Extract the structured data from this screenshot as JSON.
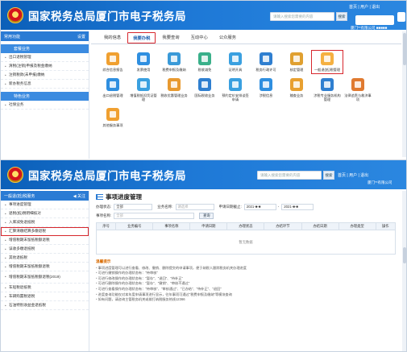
{
  "site_title": "国家税务总局厦门市电子税务局",
  "colors": {
    "banner": "#1d78d6",
    "highlight": "#d7262c",
    "accent": "#2a7bd4"
  },
  "shot1": {
    "search_placeholder": "请输入搜索您需要的内容",
    "search_button": "搜索",
    "top_links": "首页 | 用户 | 退出",
    "user_name": "厦门**有限公司 ■■■■■",
    "sidebar": {
      "head_label": "常用功能",
      "head_action": "设置",
      "groups": [
        {
          "label": "套餐业务",
          "items": [
            "出口退税管理",
            "清税(注销)申报及税金缴纳",
            "注销税款(未申报)缴纳",
            "新办税务信息"
          ]
        },
        {
          "label": "特色业务",
          "items": [
            "社保业务"
          ]
        }
      ]
    },
    "tabs": [
      "我的信息",
      "我要办税",
      "我要查询",
      "互动中心",
      "公众服务"
    ],
    "tiles": [
      "综合信息报告",
      "发票使用",
      "税费申报及缴纳",
      "税收减免",
      "证明开具",
      "税务行政许可",
      "核定管理",
      "一般退(抵)税管理",
      "",
      "出口退税管理",
      "增值税抵扣凭证管理",
      "税收优惠管理业务",
      "国际税收业务",
      "预约定价安排谈签申请",
      "涉税信息",
      "稽查业务",
      "涉税专业服务机构管理",
      "法律追责与救济事项",
      "其他服务事项"
    ],
    "highlight_index": 7
  },
  "shot2": {
    "search_placeholder": "请输入搜索您需要的内容",
    "search_button": "搜索",
    "top_links": "首页 | 用户 | 退出",
    "user_name": "厦门**有限公司",
    "sidebar": {
      "head_label": "一般退(抵)税服务",
      "head_action": "◀ 关注",
      "items": [
        "事项进度管理",
        "退税(抵)税明细核对",
        "入库减免退抵税",
        "汇算清缴结算多缴退税",
        "增值税期末留抵税额退税",
        "误收多缴退抵税",
        "其他退抵税",
        "增值税期末留抵税额退税",
        "增值税期末留抵税额退税(2019)",
        "车船税退抵税",
        "车辆购置税退税",
        "石油特别收益金退抵税"
      ],
      "highlight_index": 3
    },
    "panel_title": "事项进度管理",
    "filters": {
      "item_status_label": "办理状态:",
      "item_status_value": "全部",
      "tax_type_label": "业务名称:",
      "tax_type_value": "请选择",
      "date_label": "申请日期截止:",
      "date_from": "2021-■-■",
      "date_sep": "-",
      "date_to": "2021-■-■",
      "item_name_label": "事项名称:",
      "item_name_value": "全部",
      "query_button": "查询"
    },
    "table": {
      "headers": [
        "序号",
        "业务编号",
        "事项名称",
        "申请日期",
        "办理状态",
        "办结环节",
        "办结日期",
        "办理类型",
        "操作"
      ],
      "empty_text": "暂无数据"
    },
    "tips": {
      "title": "温馨提示",
      "lines": [
        "事项进度管理可以进行查看、修改、撤销、删除提交的申请事项，便于纳税人跟踪税务机关办理进度",
        "可进行撤销操作的办理状态有：\"待审核\"",
        "可进行修改操作的办理状态有：\"暂存\"、\"退回\"、\"待补正\"",
        "可进行删除操作的办理状态有：\"暂存\"、\"撤销\"、\"审核不通过\"",
        "可进行查看操作的办理状态有：\"待审核\"、\"审核通过\"、\"已办结\"、\"待补正\"、\"退回\"",
        "进度查询功能仅对本年度申请事项进行显示，往年事项可通过\"税费申报及缴纳\"等模块查询",
        "如有问题，请咨询主管税务机关或拨打纳税服务热线12366"
      ]
    }
  }
}
